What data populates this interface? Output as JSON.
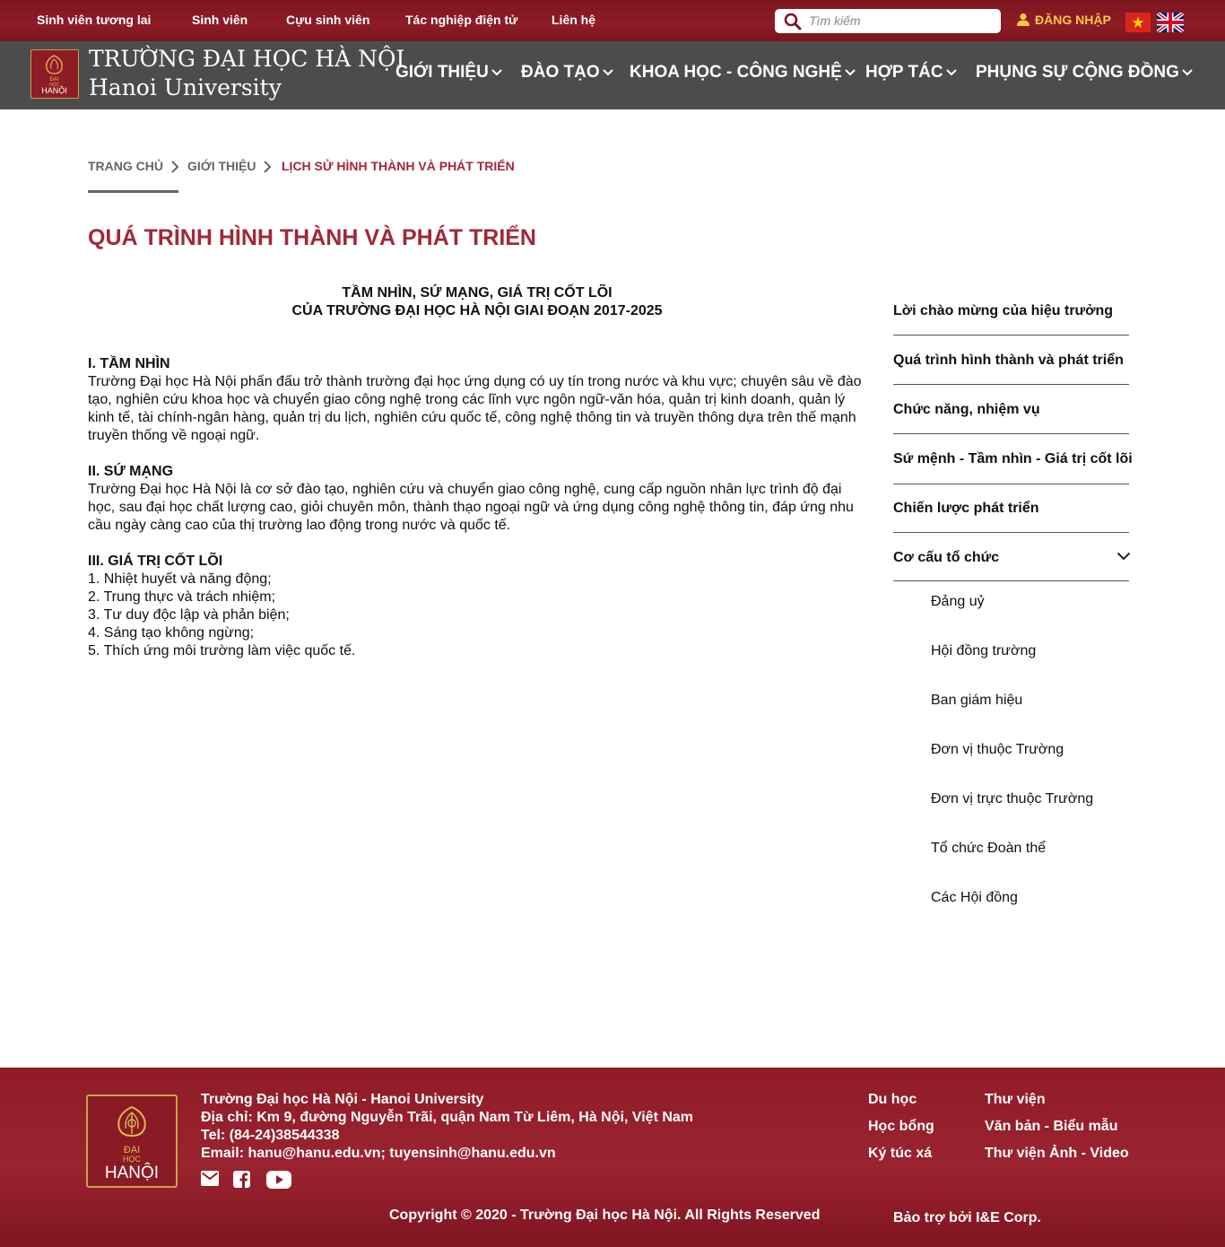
{
  "topbar": {
    "links": [
      "Sinh viên tương lai",
      "Sinh viên",
      "Cựu sinh viên",
      "Tác nghiệp điện tử",
      "Liên hệ"
    ],
    "search_placeholder": "Tìm kiếm",
    "login_label": "ĐĂNG NHẬP"
  },
  "header": {
    "brand_vi": "TRƯỜNG ĐẠI HỌC HÀ NỘI",
    "brand_en": "Hanoi University",
    "logo_text": [
      "ĐẠI",
      "HỌC",
      "HANỘI"
    ],
    "nav": [
      "GIỚI THIỆU",
      "ĐÀO TẠO",
      "KHOA HỌC - CÔNG NGHỆ",
      "HỢP TÁC",
      "PHỤNG SỰ CỘNG ĐỒNG"
    ]
  },
  "breadcrumb": {
    "items": [
      "TRANG CHỦ",
      "GIỚI THIỆU",
      "LỊCH SỬ HÌNH THÀNH VÀ PHÁT TRIỂN"
    ]
  },
  "page_title": "QUÁ TRÌNH HÌNH THÀNH VÀ PHÁT TRIỂN",
  "article": {
    "heading_line1": "TẦM NHÌN, SỨ MẠNG, GIÁ TRỊ CỐT LÕI",
    "heading_line2": "CỦA TRƯỜNG ĐẠI HỌC HÀ NỘI GIAI ĐOẠN 2017-2025",
    "vision_title": "I. TẦM NHÌN",
    "vision_text": "Trường Đại học Hà Nội phấn đấu trở thành trường đại học ứng dụng có uy tín trong nước và khu vực; chuyên sâu về đào tạo, nghiên cứu khoa học và chuyển giao công nghệ trong các lĩnh vực ngôn ngữ-văn hóa, quản trị kinh doanh, quản lý kinh tế, tài chính-ngân hàng, quản trị du lịch, nghiên cứu quốc tế, công nghệ thông tin và truyền thông dựa trên thế mạnh truyền thống về ngoại ngữ.",
    "mission_title": "II. SỨ MẠNG",
    "mission_text": "Trường Đại học Hà Nội là cơ sở đào tạo, nghiên cứu và chuyển giao công nghệ, cung cấp nguồn nhân lực trình độ đại học, sau đại học chất lượng cao, giỏi chuyên môn, thành thạo ngoại ngữ và ứng dụng công nghệ thông tin, đáp ứng nhu cầu ngày càng cao của thị trường lao động trong nước và quốc tế.",
    "values_title": "III. GIÁ TRỊ CỐT LÕI",
    "values": [
      "1. Nhiệt huyết và năng động;",
      "2. Trung thực và trách nhiệm;",
      "3. Tư duy độc lập và phản biện;",
      "4. Sáng tạo không ngừng;",
      "5. Thích ứng môi trường làm việc quốc tế."
    ]
  },
  "sidebar": {
    "items": [
      "Lời chào mừng của hiệu trưởng",
      "Quá trình hình thành và phát triển",
      "Chức năng, nhiệm vụ",
      "Sứ mệnh - Tầm nhìn - Giá trị cốt lõi",
      "Chiến lược phát triển",
      "Cơ cấu tổ chức"
    ],
    "subitems": [
      "Đảng uỷ",
      "Hội đồng trường",
      "Ban giám hiệu",
      "Đơn vị thuộc Trường",
      "Đơn vị trực thuộc Trường",
      "Tổ chức Đoàn thể",
      "Các Hội đồng"
    ]
  },
  "footer": {
    "lines": [
      "Trường Đại học Hà Nội - Hanoi University",
      "Địa chỉ: Km 9, đường Nguyễn Trãi, quận Nam Từ Liêm, Hà Nội, Việt Nam",
      "Tel: (84-24)38544338",
      "Email: hanu@hanu.edu.vn; tuyensinh@hanu.edu.vn"
    ],
    "links_col1": [
      "Du học",
      "Học bổng",
      "Ký túc xá"
    ],
    "links_col2": [
      "Thư viện",
      "Văn bản - Biểu mẫu",
      "Thư viện Ảnh - Video"
    ],
    "copyright": "Copyright © 2020 - Trường Đại học Hà Nội. All Rights Reserved",
    "sponsor": "Bảo trợ bởi I&E Corp."
  },
  "colors": {
    "brand_red": "#8e1c26",
    "accent_text": "#a1283a",
    "nav_gray": "#4c4c4c",
    "gold": "#c9a34a",
    "login_yellow": "#f6c945"
  },
  "icons": [
    "search-icon",
    "user-icon",
    "vietnam-flag-icon",
    "uk-flag-icon",
    "chevron-down-icon",
    "chevron-right-icon",
    "mail-icon",
    "facebook-icon",
    "youtube-icon",
    "university-logo-icon"
  ]
}
